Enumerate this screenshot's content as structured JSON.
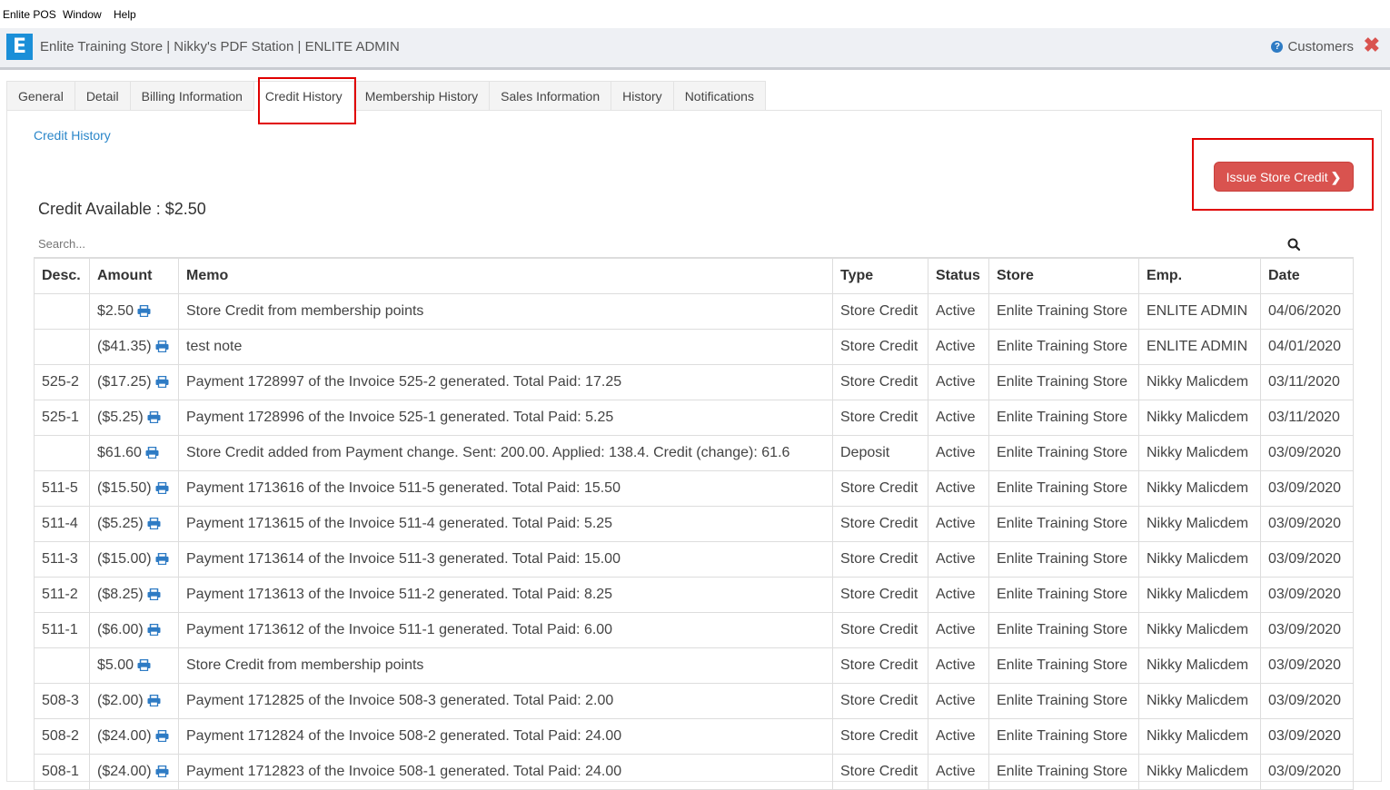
{
  "menubar": {
    "items": [
      "Enlite POS",
      "Window",
      "Help"
    ]
  },
  "titlebar": {
    "logo": "E",
    "title": "Enlite Training Store | Nikky's PDF Station | ENLITE ADMIN",
    "help_label": "Customers",
    "close_icon": "close-icon"
  },
  "tabs": [
    {
      "label": "General"
    },
    {
      "label": "Detail"
    },
    {
      "label": "Billing Information"
    },
    {
      "label": "Credit History",
      "active": true
    },
    {
      "label": "Membership History"
    },
    {
      "label": "Sales Information"
    },
    {
      "label": "History"
    },
    {
      "label": "Notifications"
    }
  ],
  "breadcrumb": "Credit History",
  "issue_button": {
    "label": "Issue Store Credit",
    "chevron": "❯"
  },
  "credit_available": "Credit Available : $2.50",
  "search": {
    "placeholder": "Search...",
    "value": ""
  },
  "table": {
    "columns": [
      "Desc.",
      "Amount",
      "Memo",
      "Type",
      "Status",
      "Store",
      "Emp.",
      "Date"
    ],
    "rows": [
      {
        "desc": "",
        "amount": "$2.50",
        "memo": "Store Credit from membership points",
        "type": "Store Credit",
        "status": "Active",
        "store": "Enlite Training Store",
        "emp": "ENLITE ADMIN",
        "date": "04/06/2020"
      },
      {
        "desc": "",
        "amount": "($41.35)",
        "memo": "test note",
        "type": "Store Credit",
        "status": "Active",
        "store": "Enlite Training Store",
        "emp": "ENLITE ADMIN",
        "date": "04/01/2020"
      },
      {
        "desc": "525-2",
        "amount": "($17.25)",
        "memo": "Payment 1728997 of the Invoice 525-2 generated. Total Paid: 17.25",
        "type": "Store Credit",
        "status": "Active",
        "store": "Enlite Training Store",
        "emp": "Nikky Malicdem",
        "date": "03/11/2020"
      },
      {
        "desc": "525-1",
        "amount": "($5.25)",
        "memo": "Payment 1728996 of the Invoice 525-1 generated. Total Paid: 5.25",
        "type": "Store Credit",
        "status": "Active",
        "store": "Enlite Training Store",
        "emp": "Nikky Malicdem",
        "date": "03/11/2020"
      },
      {
        "desc": "",
        "amount": "$61.60",
        "memo": "Store Credit added from Payment change. Sent: 200.00. Applied: 138.4. Credit (change): 61.6",
        "type": "Deposit",
        "status": "Active",
        "store": "Enlite Training Store",
        "emp": "Nikky Malicdem",
        "date": "03/09/2020"
      },
      {
        "desc": "511-5",
        "amount": "($15.50)",
        "memo": "Payment 1713616 of the Invoice 511-5 generated. Total Paid: 15.50",
        "type": "Store Credit",
        "status": "Active",
        "store": "Enlite Training Store",
        "emp": "Nikky Malicdem",
        "date": "03/09/2020"
      },
      {
        "desc": "511-4",
        "amount": "($5.25)",
        "memo": "Payment 1713615 of the Invoice 511-4 generated. Total Paid: 5.25",
        "type": "Store Credit",
        "status": "Active",
        "store": "Enlite Training Store",
        "emp": "Nikky Malicdem",
        "date": "03/09/2020"
      },
      {
        "desc": "511-3",
        "amount": "($15.00)",
        "memo": "Payment 1713614 of the Invoice 511-3 generated. Total Paid: 15.00",
        "type": "Store Credit",
        "status": "Active",
        "store": "Enlite Training Store",
        "emp": "Nikky Malicdem",
        "date": "03/09/2020"
      },
      {
        "desc": "511-2",
        "amount": "($8.25)",
        "memo": "Payment 1713613 of the Invoice 511-2 generated. Total Paid: 8.25",
        "type": "Store Credit",
        "status": "Active",
        "store": "Enlite Training Store",
        "emp": "Nikky Malicdem",
        "date": "03/09/2020"
      },
      {
        "desc": "511-1",
        "amount": "($6.00)",
        "memo": "Payment 1713612 of the Invoice 511-1 generated. Total Paid: 6.00",
        "type": "Store Credit",
        "status": "Active",
        "store": "Enlite Training Store",
        "emp": "Nikky Malicdem",
        "date": "03/09/2020"
      },
      {
        "desc": "",
        "amount": "$5.00",
        "memo": "Store Credit from membership points",
        "type": "Store Credit",
        "status": "Active",
        "store": "Enlite Training Store",
        "emp": "Nikky Malicdem",
        "date": "03/09/2020"
      },
      {
        "desc": "508-3",
        "amount": "($2.00)",
        "memo": "Payment 1712825 of the Invoice 508-3 generated. Total Paid: 2.00",
        "type": "Store Credit",
        "status": "Active",
        "store": "Enlite Training Store",
        "emp": "Nikky Malicdem",
        "date": "03/09/2020"
      },
      {
        "desc": "508-2",
        "amount": "($24.00)",
        "memo": "Payment 1712824 of the Invoice 508-2 generated. Total Paid: 24.00",
        "type": "Store Credit",
        "status": "Active",
        "store": "Enlite Training Store",
        "emp": "Nikky Malicdem",
        "date": "03/09/2020"
      },
      {
        "desc": "508-1",
        "amount": "($24.00)",
        "memo": "Payment 1712823 of the Invoice 508-1 generated. Total Paid: 24.00",
        "type": "Store Credit",
        "status": "Active",
        "store": "Enlite Training Store",
        "emp": "Nikky Malicdem",
        "date": "03/09/2020"
      }
    ]
  },
  "colors": {
    "accent": "#1b8fd8",
    "button": "#d9534f",
    "link": "#2a86c9",
    "highlight_box": "#e00000"
  }
}
